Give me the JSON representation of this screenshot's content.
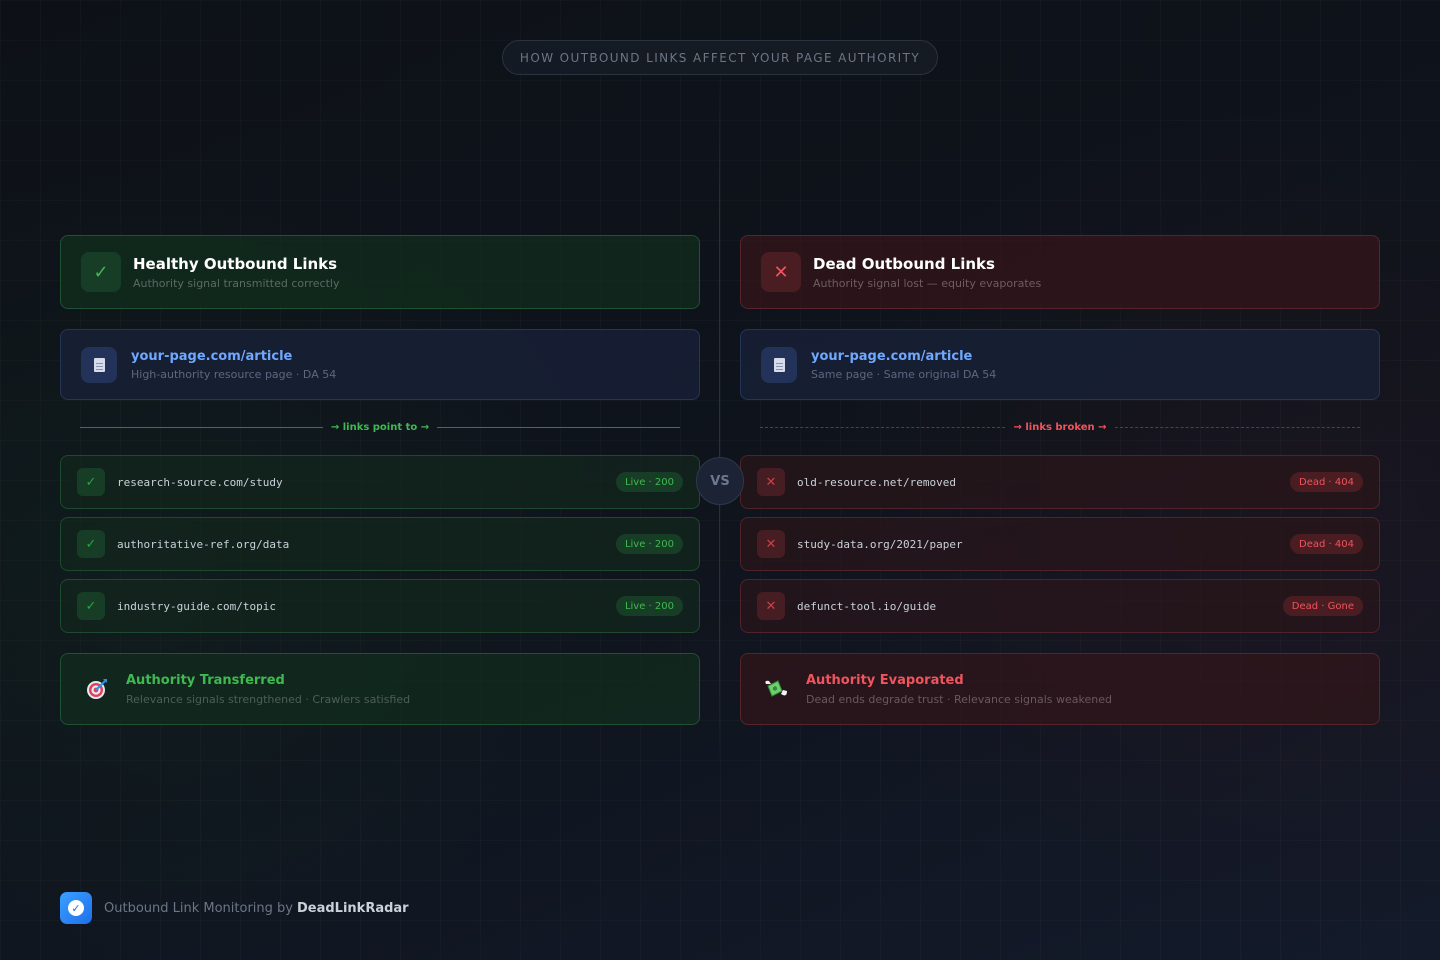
{
  "title": "HOW OUTBOUND LINKS AFFECT YOUR PAGE AUTHORITY",
  "vs_label": "VS",
  "healthy": {
    "icon": "check-icon",
    "icon_glyph": "✓",
    "title": "Healthy Outbound Links",
    "subtitle": "Authority signal transmitted correctly",
    "page": {
      "url": "your-page.com/article",
      "subtitle": "High-authority resource page · DA 54"
    },
    "divider_label": "→ links point to →",
    "links": [
      {
        "url": "research-source.com/study",
        "status": "Live · 200",
        "glyph": "✓"
      },
      {
        "url": "authoritative-ref.org/data",
        "status": "Live · 200",
        "glyph": "✓"
      },
      {
        "url": "industry-guide.com/topic",
        "status": "Live · 200",
        "glyph": "✓"
      }
    ],
    "result": {
      "icon": "target-icon",
      "title": "Authority Transferred",
      "subtitle": "Relevance signals strengthened · Crawlers satisfied"
    }
  },
  "dead": {
    "icon": "cross-icon",
    "icon_glyph": "✕",
    "title": "Dead Outbound Links",
    "subtitle": "Authority signal lost — equity evaporates",
    "page": {
      "url": "your-page.com/article",
      "subtitle": "Same page · Same original DA 54"
    },
    "divider_label": "→ links broken →",
    "links": [
      {
        "url": "old-resource.net/removed",
        "status": "Dead · 404",
        "glyph": "✕"
      },
      {
        "url": "study-data.org/2021/paper",
        "status": "Dead · 404",
        "glyph": "✕"
      },
      {
        "url": "defunct-tool.io/guide",
        "status": "Dead · Gone",
        "glyph": "✕"
      }
    ],
    "result": {
      "icon": "flying-money-icon",
      "title": "Authority Evaporated",
      "subtitle": "Dead ends degrade trust · Relevance signals weakened"
    }
  },
  "footer": {
    "text": "Outbound Link Monitoring by",
    "brand": "DeadLinkRadar",
    "logo_glyph": "✓"
  },
  "colors": {
    "healthy_accent": "#3fb950",
    "dead_accent": "#f0545c",
    "page_accent": "#6fa8ff",
    "background": "#0d1117"
  }
}
